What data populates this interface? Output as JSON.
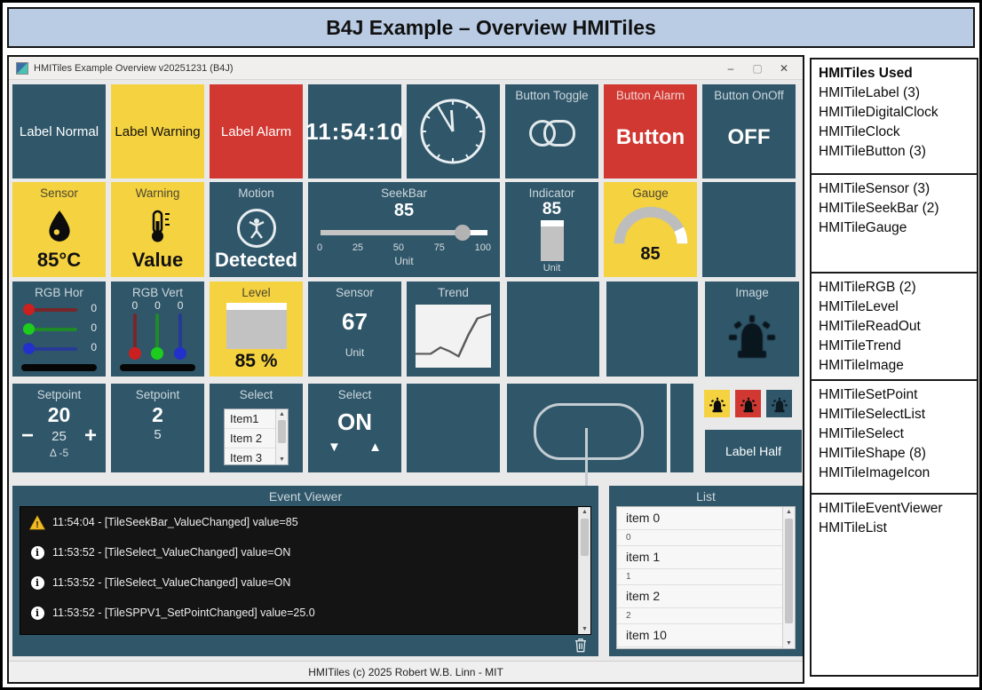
{
  "banner": {
    "title": "B4J Example – Overview HMITiles"
  },
  "window": {
    "title": "HMITiles Example Overview v20251231 (B4J)",
    "controls": {
      "minimize": "–",
      "maximize": "▢",
      "close": "✕"
    },
    "status_bar": "HMITiles (c) 2025 Robert W.B. Linn - MIT"
  },
  "colors": {
    "tile_teal": "#2f5669",
    "tile_yellow": "#f5d240",
    "tile_red": "#d23832",
    "banner_blue": "#b9cce4",
    "canvas_gray": "#e9e9e9",
    "log_black": "#141414"
  },
  "tiles": {
    "label_normal": "Label Normal",
    "label_warning": "Label Warning",
    "label_alarm": "Label Alarm",
    "digital_clock": "11:54:10",
    "button_toggle": {
      "title": "Button Toggle"
    },
    "button_alarm": {
      "title": "Button Alarm",
      "label": "Button"
    },
    "button_onoff": {
      "title": "Button OnOff",
      "label": "OFF"
    },
    "sensor": {
      "title": "Sensor",
      "value": "85°C"
    },
    "warning": {
      "title": "Warning",
      "value": "Value"
    },
    "motion": {
      "title": "Motion",
      "value": "Detected"
    },
    "seekbar": {
      "title": "SeekBar",
      "value": "85",
      "percent": 85,
      "ticks": [
        "0",
        "25",
        "50",
        "75",
        "100"
      ],
      "unit": "Unit"
    },
    "indicator": {
      "title": "Indicator",
      "value": "85",
      "percent": 85,
      "unit": "Unit"
    },
    "gauge": {
      "title": "Gauge",
      "value": "85",
      "percent": 85
    },
    "rgb_hor": {
      "title": "RGB Hor",
      "values": [
        "0",
        "0",
        "0"
      ]
    },
    "rgb_vert": {
      "title": "RGB Vert",
      "values": [
        "0",
        "0",
        "0"
      ]
    },
    "level": {
      "title": "Level",
      "value": "85 %",
      "percent": 85
    },
    "readout": {
      "title": "Sensor",
      "value": "67",
      "unit": "Unit"
    },
    "trend": {
      "title": "Trend"
    },
    "image": {
      "title": "Image"
    },
    "setpoint1": {
      "title": "Setpoint",
      "value": "20",
      "minus": "−",
      "plus": "+",
      "process_value": "25",
      "delta": "Δ -5"
    },
    "setpoint2": {
      "title": "Setpoint",
      "value": "2",
      "process_value": "5"
    },
    "select_list": {
      "title": "Select",
      "items": [
        "Item1",
        "Item 2",
        "Item 3"
      ]
    },
    "select": {
      "title": "Select",
      "value": "ON",
      "down": "▼",
      "up": "▲"
    },
    "label_half": "Label Half",
    "event_viewer": {
      "title": "Event Viewer",
      "entries": [
        {
          "level": "warning",
          "text": "11:54:04 - [TileSeekBar_ValueChanged] value=85"
        },
        {
          "level": "info",
          "text": "11:53:52 - [TileSelect_ValueChanged] value=ON"
        },
        {
          "level": "info",
          "text": "11:53:52 - [TileSelect_ValueChanged] value=ON"
        },
        {
          "level": "info",
          "text": "11:53:52 - [TileSPPV1_SetPointChanged] value=25.0"
        }
      ]
    },
    "list": {
      "title": "List",
      "items": [
        {
          "label": "item 0",
          "sub": "0"
        },
        {
          "label": "item 1",
          "sub": "1"
        },
        {
          "label": "item 2",
          "sub": "2"
        },
        {
          "label": "item 10",
          "sub": ""
        }
      ]
    }
  },
  "chart_data": {
    "type": "line",
    "title": "Trend",
    "x": [
      0,
      20,
      33,
      45,
      57,
      70,
      82,
      100
    ],
    "values": [
      22,
      22,
      32,
      26,
      18,
      52,
      78,
      85
    ],
    "xlabel": "",
    "ylabel": "",
    "ylim": [
      0,
      100
    ],
    "grid": false,
    "legend": "none"
  },
  "sidebar": {
    "sections": [
      {
        "header": "HMITiles Used",
        "items": [
          "HMITileLabel (3)",
          "HMITileDigitalClock",
          "HMITileClock",
          "HMITileButton (3)"
        ]
      },
      {
        "header": "",
        "items": [
          "HMITileSensor (3)",
          "HMITileSeekBar (2)",
          "HMITileGauge"
        ]
      },
      {
        "header": "",
        "items": [
          "HMITileRGB (2)",
          "HMITileLevel",
          "HMITileReadOut",
          "HMITileTrend",
          "HMITileImage"
        ]
      },
      {
        "header": "",
        "items": [
          "HMITileSetPoint",
          "HMITileSelectList",
          "HMITileSelect",
          "HMITileShape (8)",
          "HMITileImageIcon"
        ]
      },
      {
        "header": "",
        "items": [
          "HMITileEventViewer",
          "HMITileList"
        ]
      }
    ]
  }
}
